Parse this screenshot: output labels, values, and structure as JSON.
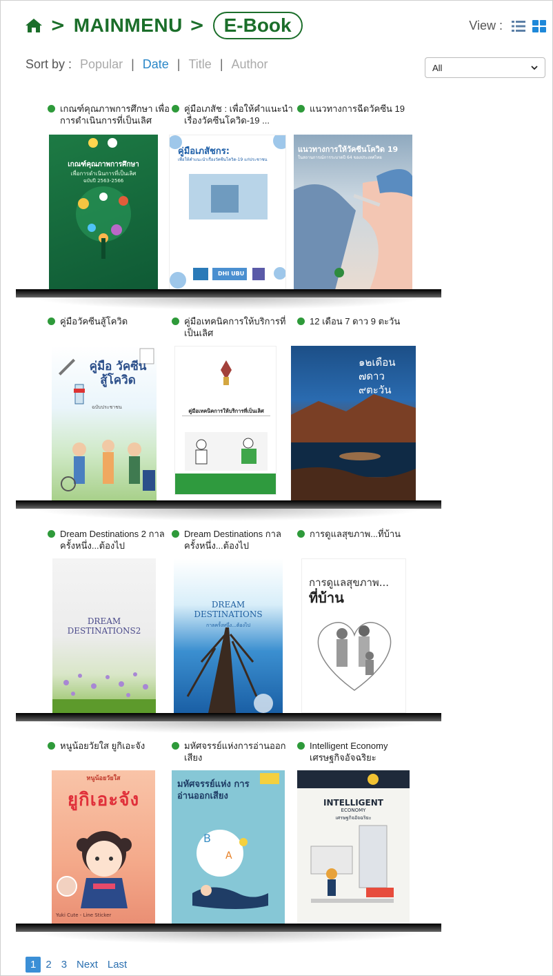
{
  "header": {
    "breadcrumb_root": "MAINMENU",
    "breadcrumb_current": "E-Book",
    "separator": ">",
    "view_label": "View :",
    "accent_color": "#1b6e2a"
  },
  "sort": {
    "label": "Sort by :",
    "options": [
      "Popular",
      "Date",
      "Title",
      "Author"
    ],
    "active": "Date",
    "filter_value": "All"
  },
  "books": [
    {
      "title": "เกณฑ์คุณภาพการศึกษา เพื่อการดำเนินการที่เป็นเลิศ",
      "cover_title": "เกณฑ์คุณภาพการศึกษา",
      "cover_subtitle": "เพื่อการดำเนินการที่เป็นเลิศ",
      "cover_extra": "ฉบับปี 2563-2566"
    },
    {
      "title": "คู่มือเภสัช : เพื่อให้คำแนะนำเรื่องวัคซีนโควิด-19 ...",
      "cover_title": "คู่มือเภสัชกร:",
      "cover_subtitle": "เพื่อให้คำแนะนำเรื่องวัคซีนโควิด-19 แก่ประชาชน",
      "cover_extra": "DHI UBU"
    },
    {
      "title": "แนวทางการฉีดวัคซีน 19",
      "cover_title": "แนวทางการให้วัคซีนโควิด 19",
      "cover_subtitle": "ในสถานการณ์การระบาดปี 64 ของประเทศไทย",
      "cover_extra": ""
    },
    {
      "title": "คู่มือวัคซีนสู้โควิด",
      "cover_title": "คู่มือ วัคซีน สู้โควิด",
      "cover_subtitle": "ฉบับประชาชน",
      "cover_extra": ""
    },
    {
      "title": "คู่มือเทคนิคการให้บริการที่เป็นเลิศ",
      "cover_title": "คู่มือเทคนิคการให้บริการที่เป็นเลิศ",
      "cover_subtitle": "",
      "cover_extra": ""
    },
    {
      "title": "12 เดือน 7 ดาว 9 ตะวัน",
      "cover_title": "๑๒เดือน ๗ดาว ๙ตะวัน",
      "cover_subtitle": "",
      "cover_extra": ""
    },
    {
      "title": "Dream Destinations 2 กาลครั้งหนึ่ง...ต้องไป",
      "cover_title": "DREAM DESTINATIONS2",
      "cover_subtitle": "",
      "cover_extra": ""
    },
    {
      "title": "Dream Destinations กาลครั้งหนึ่ง...ต้องไป",
      "cover_title": "DREAM DESTINATIONS",
      "cover_subtitle": "กาลครั้งหนึ่ง...ต้องไป",
      "cover_extra": ""
    },
    {
      "title": "การดูแลสุขภาพ...ที่บ้าน",
      "cover_title": "การดูแลสุขภาพ...",
      "cover_subtitle": "ที่บ้าน",
      "cover_extra": ""
    },
    {
      "title": "หนูน้อยวัยใส ยูกิเอะจัง",
      "cover_title": "ยูกิเอะจัง",
      "cover_subtitle": "หนูน้อยวัยใส",
      "cover_extra": "Yuki Cute - Line Sticker"
    },
    {
      "title": "มหัศจรรย์แห่งการอ่านออกเสียง",
      "cover_title": "มหัศจรรย์แห่ง การอ่านออกเสียง",
      "cover_subtitle": "",
      "cover_extra": ""
    },
    {
      "title": "Intelligent Economy เศรษฐกิจอัจฉริยะ",
      "cover_title": "INTELLIGENT",
      "cover_subtitle": "ECONOMY",
      "cover_extra": "เศรษฐกิจอัจฉริยะ"
    }
  ],
  "pagination": {
    "pages": [
      "1",
      "2",
      "3"
    ],
    "current": "1",
    "next": "Next",
    "last": "Last"
  }
}
